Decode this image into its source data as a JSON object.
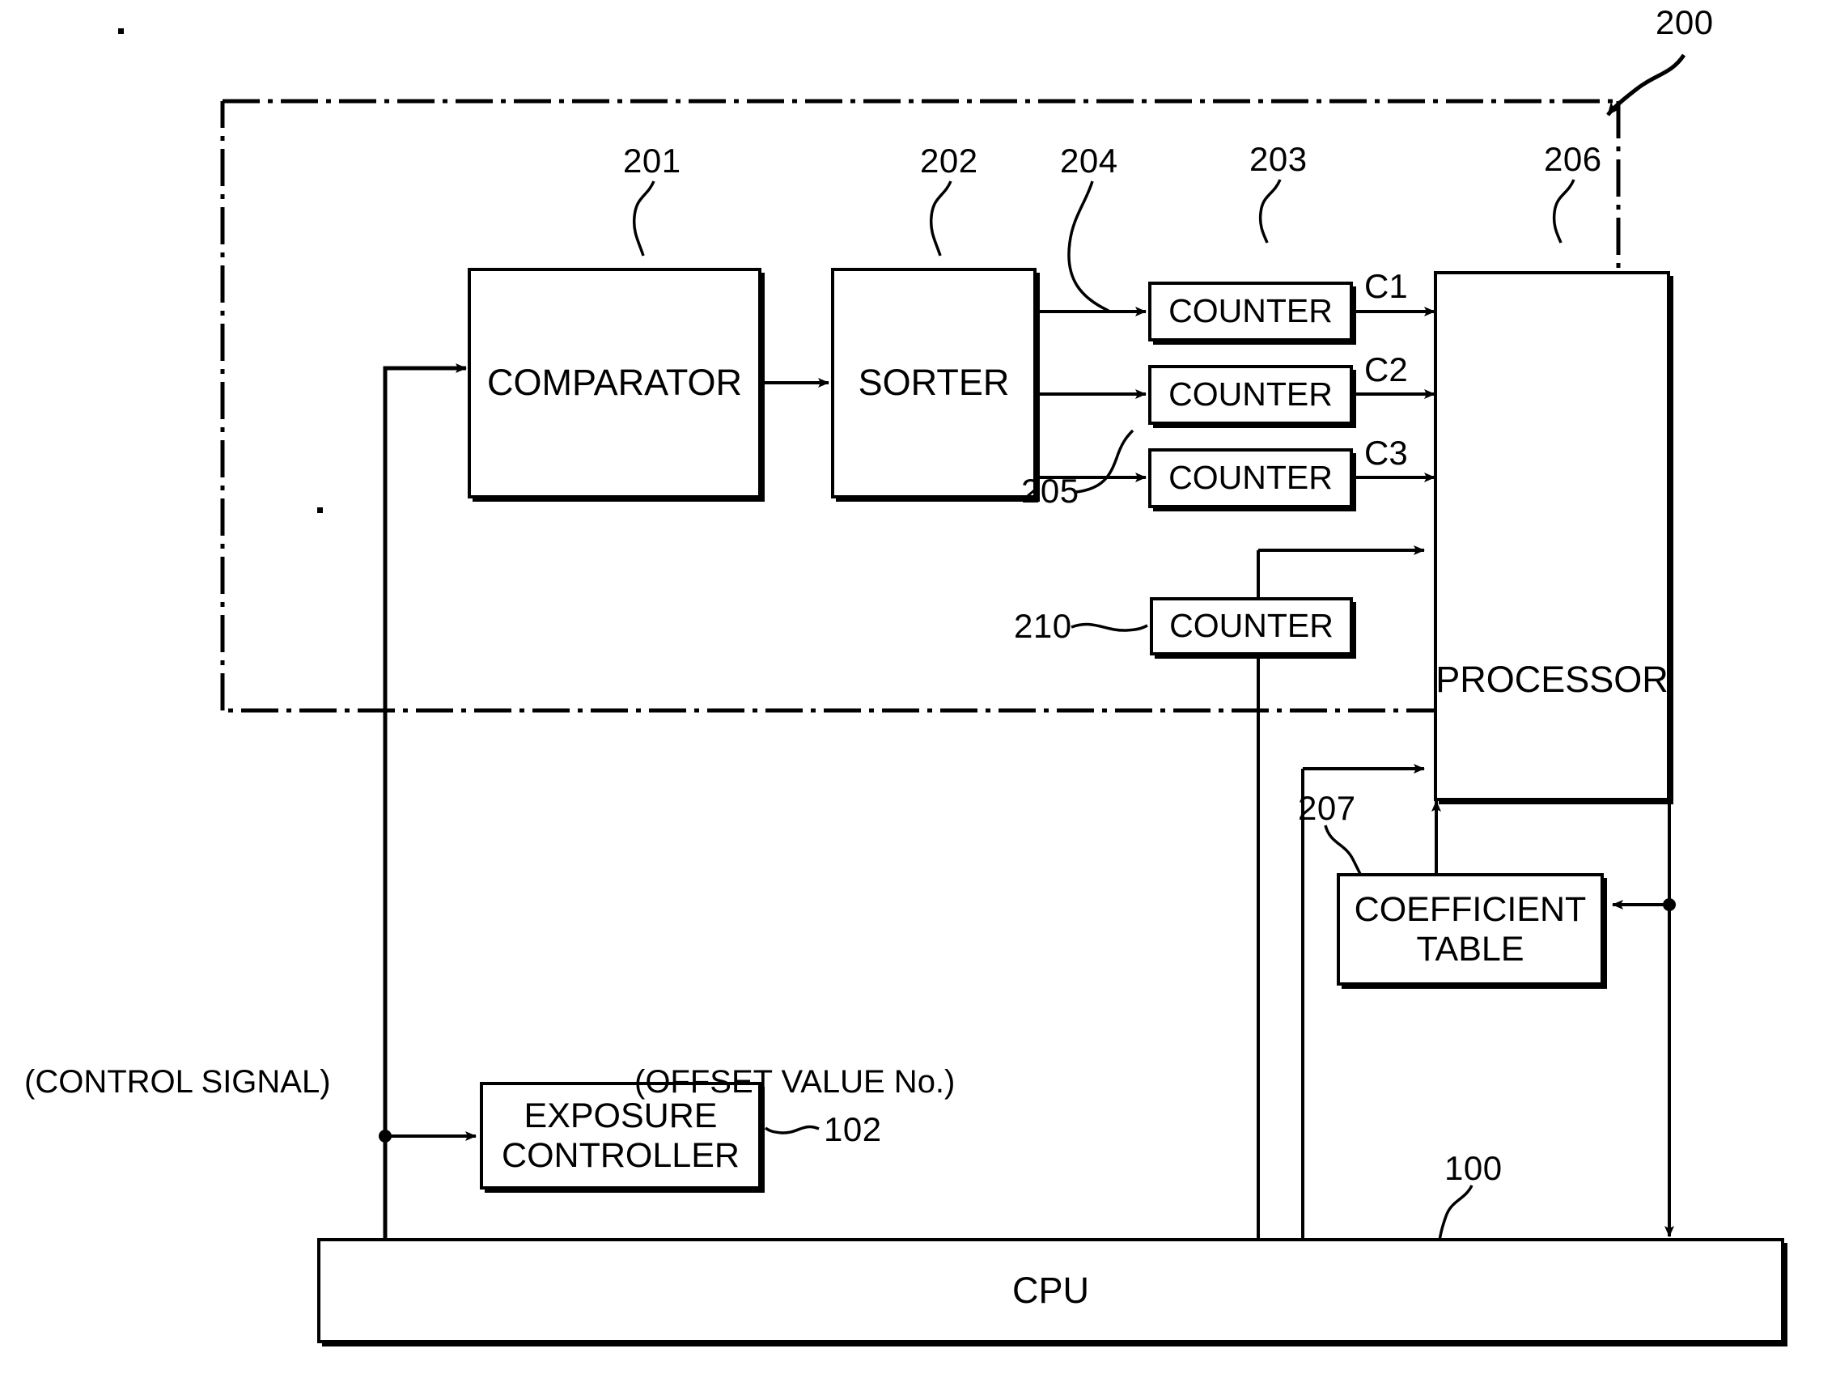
{
  "figure": {
    "type": "patent-block-diagram",
    "outer_ref": "200",
    "cpu_ref": "100"
  },
  "blocks": {
    "comparator": {
      "label": "COMPARATOR",
      "ref": "201"
    },
    "sorter": {
      "label": "SORTER",
      "ref": "202"
    },
    "counter1": {
      "label": "COUNTER",
      "ref": "203",
      "output": "C1"
    },
    "counter2": {
      "label": "COUNTER",
      "ref": "204",
      "output": "C2"
    },
    "counter3": {
      "label": "COUNTER",
      "ref": "205",
      "output": "C3"
    },
    "counter4": {
      "label": "COUNTER",
      "ref": "210"
    },
    "processor": {
      "label": "PROCESSOR",
      "ref": "206"
    },
    "coefficient_table": {
      "label_line1": "COEFFICIENT",
      "label_line2": "TABLE",
      "ref": "207"
    },
    "exposure_controller": {
      "label_line1": "EXPOSURE",
      "label_line2": "CONTROLLER",
      "ref": "102"
    },
    "cpu": {
      "label": "CPU",
      "ref": "100"
    }
  },
  "annotations": {
    "control_signal": "(CONTROL SIGNAL)",
    "offset_value": "(OFFSET VALUE No.)"
  },
  "refs": {
    "r200": "200",
    "r201": "201",
    "r202": "202",
    "r203": "203",
    "r204": "204",
    "r205": "205",
    "r206": "206",
    "r207": "207",
    "r210": "210",
    "r102": "102",
    "r100": "100"
  },
  "signals": {
    "c1": "C1",
    "c2": "C2",
    "c3": "C3"
  },
  "colors": {
    "ink": "#000000",
    "paper": "#ffffff"
  }
}
